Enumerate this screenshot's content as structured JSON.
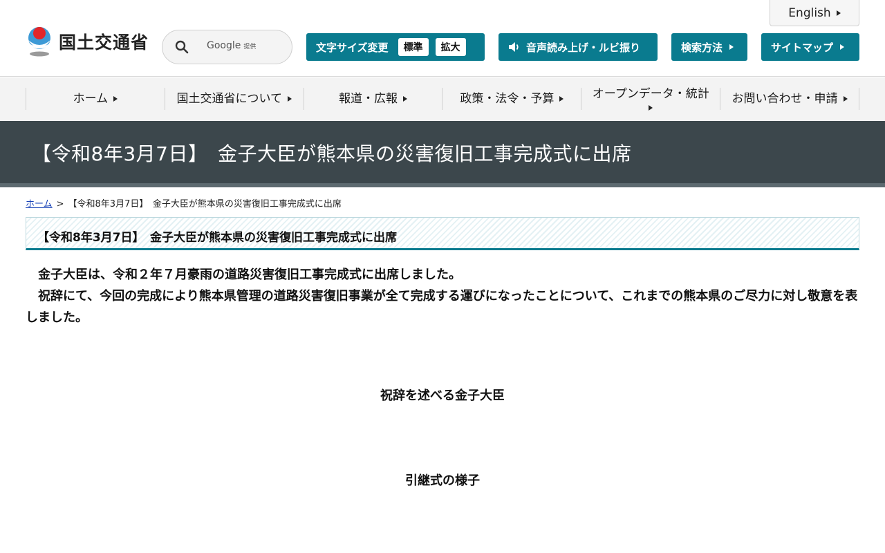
{
  "header": {
    "english_label": "English",
    "logo_text": "国土交通省",
    "search": {
      "placeholder": "",
      "provider": "Google",
      "provider_suffix": "提供"
    },
    "font_size": {
      "label": "文字サイズ変更",
      "standard": "標準",
      "large": "拡大"
    },
    "voice_label": "音声読み上げ・ルビ振り",
    "howto_label": "検索方法",
    "sitemap_label": "サイトマップ",
    "colors": {
      "accent": "#0a7b8f",
      "title_band": "#3c474c"
    }
  },
  "gnav": {
    "items": [
      {
        "label": "ホーム"
      },
      {
        "label": "国土交通省について"
      },
      {
        "label": "報道・広報"
      },
      {
        "label": "政策・法令・予算"
      },
      {
        "label": "オープンデータ・統計"
      },
      {
        "label": "お問い合わせ・申請"
      }
    ]
  },
  "page": {
    "title": "【令和8年3月7日】　金子大臣が熊本県の災害復旧工事完成式に出席",
    "breadcrumb": {
      "home": "ホーム",
      "separator": ">",
      "current": "【令和8年3月7日】　金子大臣が熊本県の災害復旧工事完成式に出席"
    },
    "heading": "【令和8年3月7日】　金子大臣が熊本県の災害復旧工事完成式に出席",
    "paragraphs": [
      "金子大臣は、令和２年７月豪雨の道路災害復旧工事完成式に出席しました。",
      "祝辞にて、今回の完成により熊本県管理の道路災害復旧事業が全て完成する運びになったことについて、これまでの熊本県のご尽力に対し敬意を表しました。"
    ],
    "captions": [
      "祝辞を述べる金子大臣",
      "引継式の様子"
    ]
  }
}
